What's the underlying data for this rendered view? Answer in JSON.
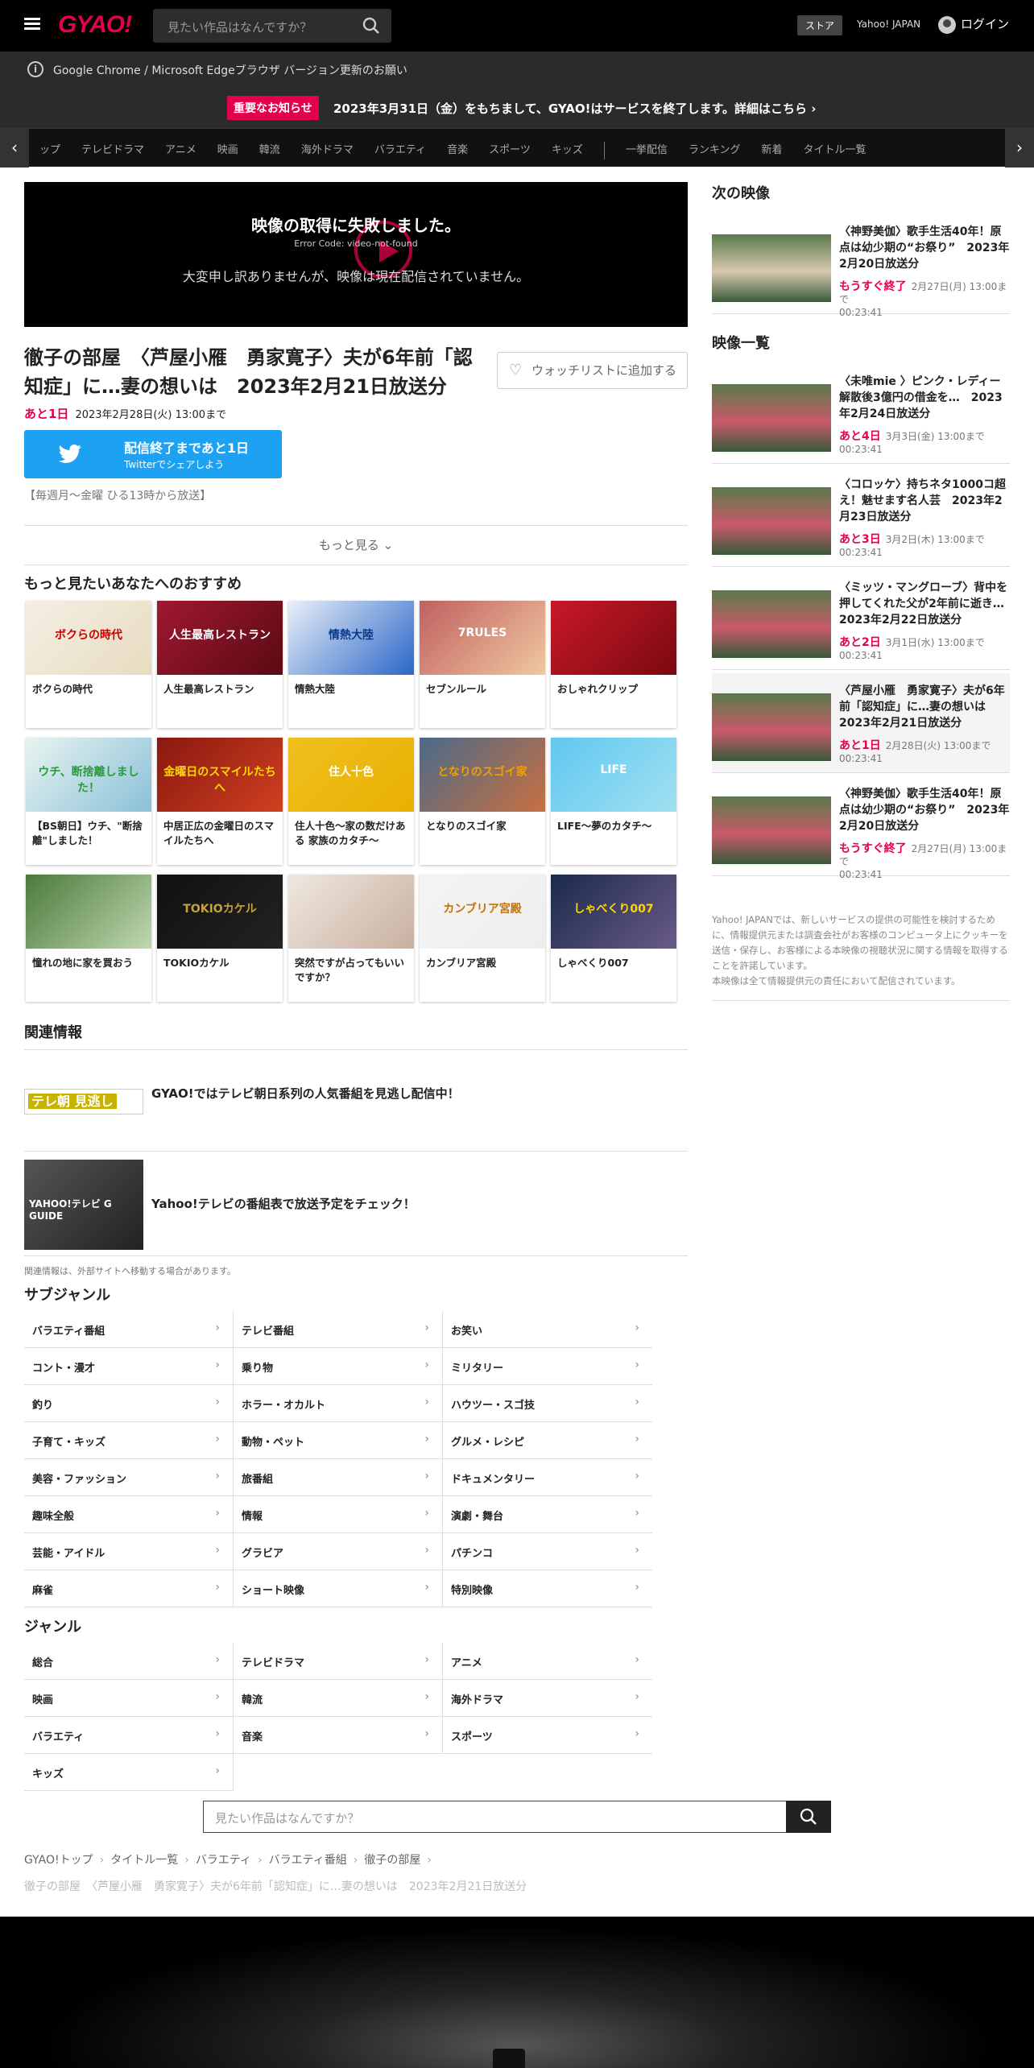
{
  "header": {
    "logo": "GYAO!",
    "search_placeholder": "見たい作品はなんですか？",
    "store": "ストア",
    "yahoo": "Yahoo! JAPAN",
    "login": "ログイン"
  },
  "notices": {
    "browser": "Google Chrome / Microsoft Edgeブラウザ バージョン更新のお願い",
    "badge": "重要なお知らせ",
    "service_end": "2023年3月31日（金）をもちまして、GYAO!はサービスを終了します。詳細はこちら"
  },
  "categories": [
    "ップ",
    "テレビドラマ",
    "アニメ",
    "映画",
    "韓流",
    "海外ドラマ",
    "バラエティ",
    "音楽",
    "スポーツ",
    "キッズ",
    "一挙配信",
    "ランキング",
    "新着",
    "タイトル一覧"
  ],
  "player": {
    "error_title": "映像の取得に失敗しました。",
    "error_code": "Error Code: video-not-found",
    "error_msg": "大変申し訳ありませんが、映像は現在配信されていません。"
  },
  "video": {
    "title": "徹子の部屋　〈芦屋小雁　勇家寛子〉夫が6年前「認知症」に…妻の想いは　2023年2月21日放送分",
    "watchlist": "ウォッチリストに追加する",
    "remain": "あと1日",
    "until": "2023年2月28日(火) 13:00まで",
    "share_l1": "配信終了まであと1日",
    "share_l2": "Twitterでシェアしよう",
    "broadcast": "【毎週月～金曜 ひる13時から放送】",
    "more": "もっと見る"
  },
  "recommend": {
    "heading": "もっと見たいあなたへのおすすめ",
    "items": [
      "ボクらの時代",
      "人生最高レストラン",
      "情熱大陸",
      "セブンルール",
      "おしゃれクリップ",
      "【BS朝日】ウチ、\"断捨離\"しました！",
      "中居正広の金曜日のスマイルたちへ",
      "住人十色～家の数だけある 家族のカタチ～",
      "となりのスゴイ家",
      "LIFE～夢のカタチ～",
      "憧れの地に家を買おう",
      "TOKIOカケル",
      "突然ですが占ってもいいですか？",
      "カンブリア宮殿",
      "しゃべくり007"
    ],
    "thumb_texts": [
      "ボクらの時代",
      "人生最高レストラン",
      "情熱大陸",
      "7RULES",
      "",
      "ウチ、断捨離しました！",
      "金曜日のスマイルたちへ",
      "住人十色",
      "となりのスゴイ家",
      "LIFE",
      "",
      "TOKIOカケル",
      "",
      "カンブリア宮殿",
      "しゃべくり007"
    ]
  },
  "related": {
    "heading": "関連情報",
    "items": [
      {
        "logo": "テレ朝 見逃し",
        "text": "GYAO!ではテレビ朝日系列の人気番組を見逃し配信中！"
      },
      {
        "logo": "YAHOO!テレビ G GUIDE",
        "text": "Yahoo!テレビの番組表で放送予定をチェック！"
      }
    ],
    "note": "関連情報は、外部サイトへ移動する場合があります。"
  },
  "subgenre": {
    "heading": "サブジャンル",
    "items": [
      "バラエティ番組",
      "テレビ番組",
      "お笑い",
      "コント・漫才",
      "乗り物",
      "ミリタリー",
      "釣り",
      "ホラー・オカルト",
      "ハウツー・スゴ技",
      "子育て・キッズ",
      "動物・ペット",
      "グルメ・レシピ",
      "美容・ファッション",
      "旅番組",
      "ドキュメンタリー",
      "趣味全般",
      "情報",
      "演劇・舞台",
      "芸能・アイドル",
      "グラビア",
      "パチンコ",
      "麻雀",
      "ショート映像",
      "特別映像"
    ]
  },
  "genre": {
    "heading": "ジャンル",
    "items": [
      "総合",
      "テレビドラマ",
      "アニメ",
      "映画",
      "韓流",
      "海外ドラマ",
      "バラエティ",
      "音楽",
      "スポーツ",
      "キッズ"
    ]
  },
  "sidebar": {
    "next_heading": "次の映像",
    "next": {
      "title": "〈神野美伽〉歌手生活40年！原点は幼少期の“お祭り”　2023年2月20日放送分",
      "badge": "もうすぐ終了",
      "date": "2月27日(月) 13:00まで",
      "dur": "00:23:41"
    },
    "list_heading": "映像一覧",
    "list": [
      {
        "title": "〈未唯mie 〉ピンク・レディー解散後3億円の借金を…　2023年2月24日放送分",
        "badge": "あと4日",
        "date": "3月3日(金) 13:00まで",
        "dur": "00:23:41"
      },
      {
        "title": "〈コロッケ〉持ちネタ1000コ超え！魅せます名人芸　2023年2月23日放送分",
        "badge": "あと3日",
        "date": "3月2日(木) 13:00まで",
        "dur": "00:23:41"
      },
      {
        "title": "〈ミッツ・マングローブ〉背中を押してくれた父が2年前に逝き…　2023年2月22日放送分",
        "badge": "あと2日",
        "date": "3月1日(水) 13:00まで",
        "dur": "00:23:41"
      },
      {
        "title": "〈芦屋小雁　勇家寛子〉夫が6年前「認知症」に…妻の想いは　2023年2月21日放送分",
        "badge": "あと1日",
        "date": "2月28日(火) 13:00まで",
        "dur": "00:23:41"
      },
      {
        "title": "〈神野美伽〉歌手生活40年！原点は幼少期の“お祭り”　2023年2月20日放送分",
        "badge": "もうすぐ終了",
        "date": "2月27日(月) 13:00まで",
        "dur": "00:23:41"
      }
    ],
    "disclaimer": "Yahoo! JAPANでは、新しいサービスの提供の可能性を検討するために、情報提供元または調査会社がお客様のコンピュータ上にクッキーを送信・保存し、お客様による本映像の視聴状況に関する情報を取得することを許諾しています。\n本映像は全て情報提供元の責任において配信されています。"
  },
  "bottom": {
    "search_placeholder": "見たい作品はなんですか？",
    "crumbs": [
      "GYAO!トップ",
      "タイトル一覧",
      "バラエティ",
      "バラエティ番組",
      "徹子の部屋"
    ],
    "current": "徹子の部屋　〈芦屋小雁　勇家寛子〉夫が6年前「認知症」に…妻の想いは　2023年2月21日放送分"
  },
  "colors": {
    "brand": "#e5004f",
    "twitter": "#1da1f2"
  }
}
